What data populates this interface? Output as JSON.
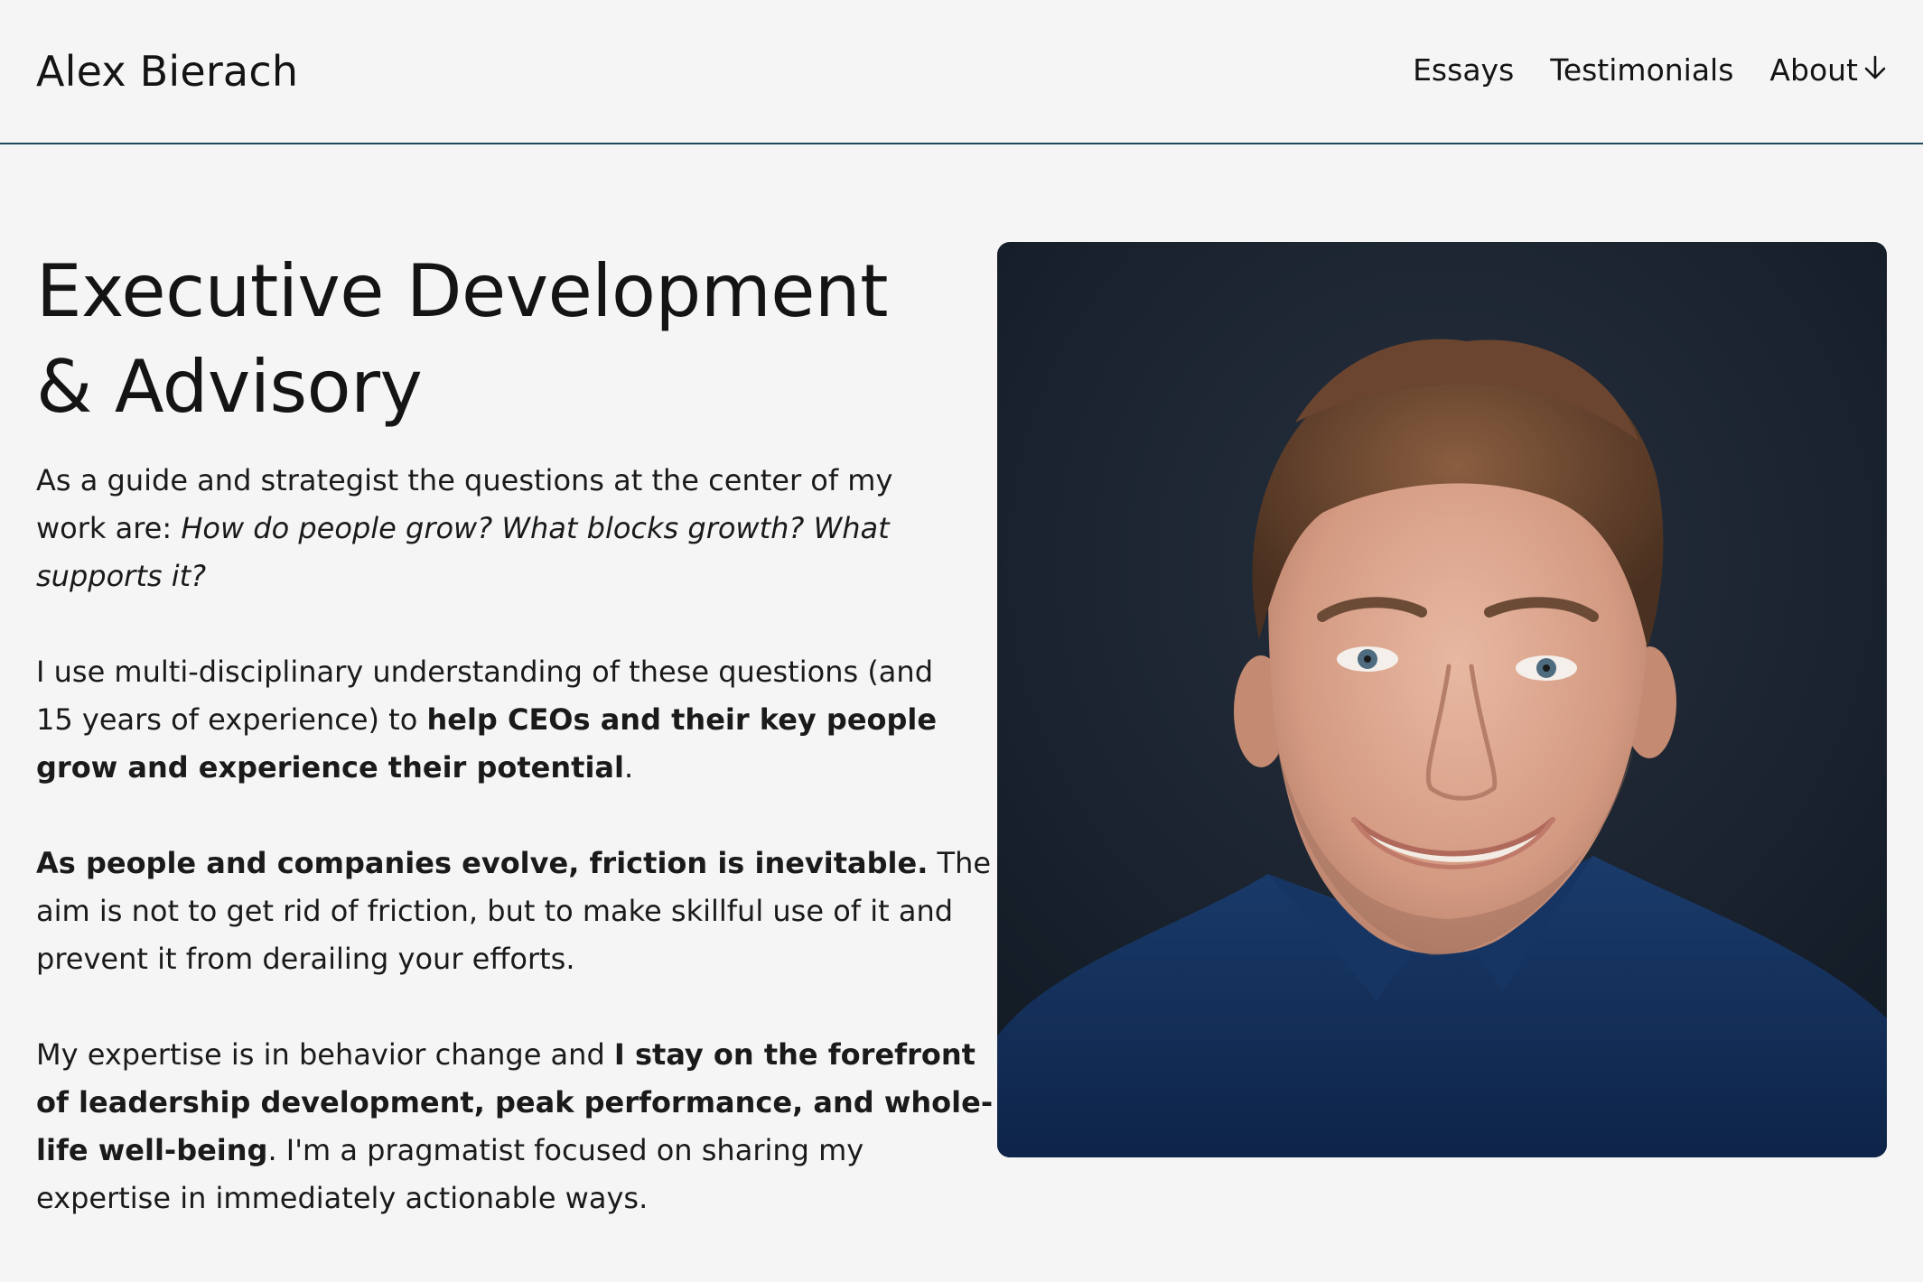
{
  "header": {
    "brand": "Alex Bierach",
    "nav": [
      {
        "label": "Essays"
      },
      {
        "label": "Testimonials"
      },
      {
        "label": "About"
      }
    ]
  },
  "hero": {
    "title_line1": "Executive Development",
    "title_line2": "& Advisory",
    "p1": {
      "l1": "As a guide and strategist the questions at the center of my",
      "l2_plain": "work are: ",
      "l2_italic": "How do people grow? What blocks growth? What",
      "l3_italic": "supports it?"
    },
    "p2": {
      "l1": "I use multi-disciplinary understanding of these questions (and",
      "l2_plain": "15 years of experience) to ",
      "l2_bold": "help CEOs and their key people",
      "l3_bold": "grow and experience their potential",
      "l3_plain": "."
    },
    "p3": {
      "l1_bold": "As people and companies evolve, friction is inevitable.",
      "l1_plain": " The",
      "l2": "aim is not to get rid of friction, but to make skillful use of it and",
      "l3": "prevent it from derailing your efforts."
    },
    "p4": {
      "l1_plain": "My expertise is in behavior change and ",
      "l1_bold": "I stay on the forefront",
      "l2_bold": "of leadership development, peak performance, and whole-",
      "l3_bold": "life well-being",
      "l3_plain": ". I'm a pragmatist focused on sharing my",
      "l4": "expertise in immediately actionable ways."
    }
  },
  "colors": {
    "background": "#f5f5f5",
    "text": "#141414",
    "header_rule": "#1d4a5c",
    "photo_backdrop": "#1a2433",
    "shirt": "#14305a"
  },
  "icons": {
    "about_dropdown": "arrow-down-icon"
  }
}
